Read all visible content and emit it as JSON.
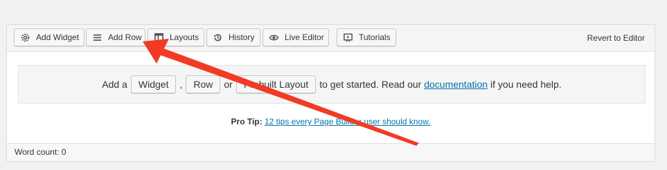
{
  "toolbar": {
    "buttons": [
      {
        "label": "Add Widget",
        "icon": "gear-icon"
      },
      {
        "label": "Add Row",
        "icon": "menu-lines-icon"
      },
      {
        "label": "Layouts",
        "icon": "layout-icon"
      },
      {
        "label": "History",
        "icon": "history-icon"
      },
      {
        "label": "Live Editor",
        "icon": "eye-icon"
      },
      {
        "label": "Tutorials",
        "icon": "video-icon"
      }
    ],
    "revert_label": "Revert to Editor"
  },
  "empty_state": {
    "prefix": "Add a",
    "widget_btn": "Widget",
    "comma": ",",
    "row_btn": "Row",
    "or": "or",
    "layout_btn": "Prebuilt Layout",
    "mid": "to get started. Read our",
    "doc_link": "documentation",
    "suffix": "if you need help."
  },
  "pro_tip": {
    "label": "Pro Tip:",
    "link": "12 tips every Page Builder user should know."
  },
  "footer": {
    "word_count": "Word count: 0"
  },
  "annotation": {
    "arrow_color": "#f23a25"
  }
}
